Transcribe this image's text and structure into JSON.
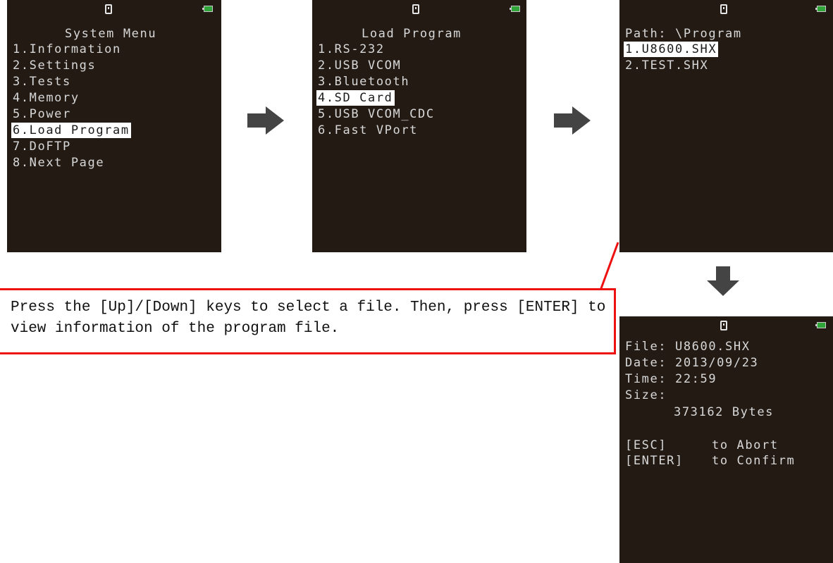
{
  "screens": {
    "system_menu": {
      "title": "System Menu",
      "items": [
        "1.Information",
        "2.Settings",
        "3.Tests",
        "4.Memory",
        "5.Power",
        "6.Load Program",
        "7.DoFTP",
        "8.Next Page"
      ],
      "selected_index": 5
    },
    "load_program": {
      "title": "Load Program",
      "items": [
        "1.RS-232",
        "2.USB VCOM",
        "3.Bluetooth",
        "4.SD Card",
        "5.USB VCOM_CDC",
        "6.Fast VPort"
      ],
      "selected_index": 3
    },
    "file_select": {
      "path": "Path: \\Program",
      "items": [
        "1.U8600.SHX",
        "2.TEST.SHX"
      ],
      "selected_index": 0
    },
    "file_info": {
      "file": "File: U8600.SHX",
      "date": "Date: 2013/09/23",
      "time": "Time: 22:59",
      "size_label": "Size:",
      "size_value": "373162 Bytes",
      "esc_key": "[ESC]",
      "esc_action": "to Abort",
      "enter_key": "[ENTER]",
      "enter_action": "to Confirm"
    }
  },
  "callout": {
    "text": "Press the [Up]/[Down] keys to select a file. Then, press [ENTER] to view information of the program file."
  },
  "icons": {
    "status": [
      "sd-card-icon",
      "battery-icon"
    ],
    "flow": [
      "arrow-right-icon",
      "arrow-right-icon",
      "arrow-down-icon"
    ]
  },
  "colors": {
    "screen_background": "#231a14",
    "screen_text": "#d8d8d8",
    "highlight": "#ffffff",
    "battery": "#2fa53a",
    "callout_border": "#ee1111",
    "arrow": "#444444"
  }
}
